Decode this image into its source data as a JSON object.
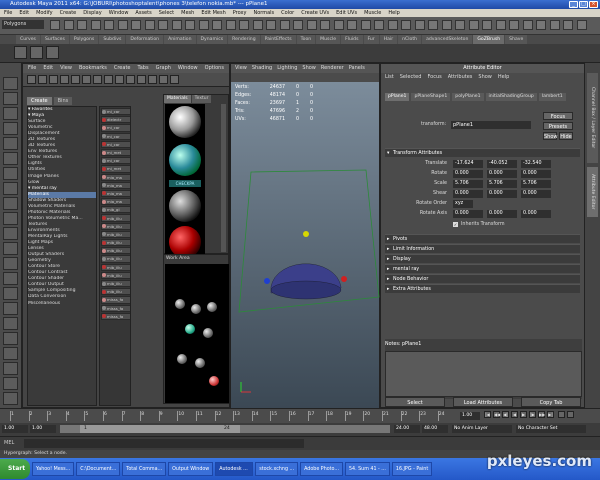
{
  "window": {
    "title": "Autodesk Maya 2011 x64: G:\\JOBURI\\photoshoptalent\\phones 3\\telefon nokia.mb* --- pPlane1"
  },
  "menubar": [
    "File",
    "Edit",
    "Modify",
    "Create",
    "Display",
    "Window",
    "Assets",
    "Select",
    "Mesh",
    "Edit Mesh",
    "Proxy",
    "Normals",
    "Color",
    "Create UVs",
    "Edit UVs",
    "Muscle",
    "Help"
  ],
  "statusline": {
    "mode": "Polygons"
  },
  "shelf": {
    "tabs": [
      "Curves",
      "Surfaces",
      "Polygons",
      "Subdivs",
      "Deformation",
      "Animation",
      "Dynamics",
      "Rendering",
      "PaintEffects",
      "Toon",
      "Muscle",
      "Fluids",
      "Fur",
      "Hair",
      "nCloth",
      "advancedSkeleton",
      "GoZBrush",
      "Shave"
    ],
    "active": "GoZBrush"
  },
  "hypershade": {
    "menu": [
      "File",
      "Edit",
      "View",
      "Bookmarks",
      "Create",
      "Tabs",
      "Graph",
      "Window",
      "Options"
    ],
    "tabs": {
      "create": "Create",
      "bins": "Bins"
    },
    "tree": [
      "Favorites",
      "Maya",
      "Surface",
      "Volumetric",
      "Displacement",
      "2D Textures",
      "3D Textures",
      "Env Textures",
      "Other Textures",
      "Lights",
      "Utilities",
      "Image Planes",
      "Glow",
      "mental ray",
      "Materials",
      "Shadow Shaders",
      "Volumetric Materials",
      "Photonic Materials",
      "Photon Volumetric Ma...",
      "Textures",
      "Environments",
      "MentalRay Lights",
      "Light Maps",
      "Lenses",
      "Output Shaders",
      "Geometry",
      "Contour Store",
      "Contour Contrast",
      "Contour Shader",
      "Contour Output",
      "Sample Compositing",
      "Data Conversion",
      "Miscellaneous"
    ],
    "tree_selected": "Materials",
    "nodes": [
      "mi_car",
      "dielectr",
      "mi_car",
      "mi_car",
      "mi_car",
      "mi_met",
      "mi_car",
      "mi_met",
      "mia_ma",
      "mia_ma",
      "mia_ma",
      "mia_ma",
      "mib_gl",
      "mib_illu",
      "mib_illu",
      "mib_illu",
      "mib_illu",
      "mib_illu",
      "mib_illu",
      "mib_illu",
      "mib_illu",
      "mib_illu",
      "mib_illu",
      "misss_fa",
      "misss_fa",
      "misss_fa"
    ],
    "material_tabs": [
      "Materials",
      "Textur"
    ],
    "swatch_label": "CHECKPA",
    "work_area": "Work Area"
  },
  "viewport": {
    "menu": [
      "View",
      "Shading",
      "Lighting",
      "Show",
      "Renderer",
      "Panels"
    ],
    "hud": [
      {
        "label": "Verts:",
        "v": "24637",
        "a": "0",
        "b": "0"
      },
      {
        "label": "Edges:",
        "v": "48174",
        "a": "0",
        "b": "0"
      },
      {
        "label": "Faces:",
        "v": "23697",
        "a": "1",
        "b": "0"
      },
      {
        "label": "Tris:",
        "v": "47696",
        "a": "2",
        "b": "0"
      },
      {
        "label": "UVs:",
        "v": "46871",
        "a": "0",
        "b": "0"
      }
    ]
  },
  "attr": {
    "title": "Attribute Editor",
    "menu": [
      "List",
      "Selected",
      "Focus",
      "Attributes",
      "Show",
      "Help"
    ],
    "node_tabs": [
      "pPlane1",
      "pPlaneShape1",
      "polyPlane1",
      "initialShadingGroup",
      "lambert1"
    ],
    "transform_label": "transform:",
    "transform_value": "pPlane1",
    "focus": "Focus",
    "presets": "Presets",
    "show": "Show",
    "hide": "Hide",
    "section": "Transform Attributes",
    "translate": {
      "label": "Translate",
      "x": "-17.624",
      "y": "-40.052",
      "z": "-32.540"
    },
    "rotate": {
      "label": "Rotate",
      "x": "0.000",
      "y": "0.000",
      "z": "0.000"
    },
    "scale": {
      "label": "Scale",
      "x": "5.706",
      "y": "5.706",
      "z": "5.706"
    },
    "shear": {
      "label": "Shear",
      "x": "0.000",
      "y": "0.000",
      "z": "0.000"
    },
    "rotorder": {
      "label": "Rotate Order",
      "v": "xyz"
    },
    "rotaxis": {
      "label": "Rotate Axis",
      "x": "0.000",
      "y": "0.000",
      "z": "0.000"
    },
    "inherits": "Inherits Transform",
    "sections": [
      "Pivots",
      "Limit Information",
      "Display",
      "mental ray",
      "Node Behavior",
      "Extra Attributes"
    ],
    "notes": "Notes: pPlane1",
    "buttons": [
      "Select",
      "Load Attributes",
      "Copy Tab"
    ]
  },
  "sidetabs": [
    "Channel Box / Layer Editor",
    "Attribute Editor"
  ],
  "timeline": {
    "ticks": [
      "1",
      "2",
      "3",
      "4",
      "5",
      "6",
      "7",
      "8",
      "9",
      "10",
      "11",
      "12",
      "13",
      "14",
      "15",
      "16",
      "17",
      "18",
      "19",
      "20",
      "21",
      "22",
      "23",
      "24"
    ],
    "current": "1.00"
  },
  "range": {
    "start": "1.00",
    "inner_start": "1.00",
    "slider_lbl": "1",
    "end_mark": "24",
    "end": "24.00",
    "outer_end": "48.00",
    "anim_layer": "No Anim Layer",
    "char_set": "No Character Set"
  },
  "mel": {
    "label": "MEL"
  },
  "help": "Hypergraph: Select a node.",
  "taskbar": {
    "start": "Start",
    "tasks": [
      "Yahoo! Mess...",
      "C:\\Document...",
      "Total Comma...",
      "Output Window",
      "Autodesk ...",
      "stock.xchng ...",
      "Adobe Photo...",
      "54. Sum 41 - ...",
      "16.JPG - Paint"
    ]
  },
  "watermark": "pxleyes.com"
}
